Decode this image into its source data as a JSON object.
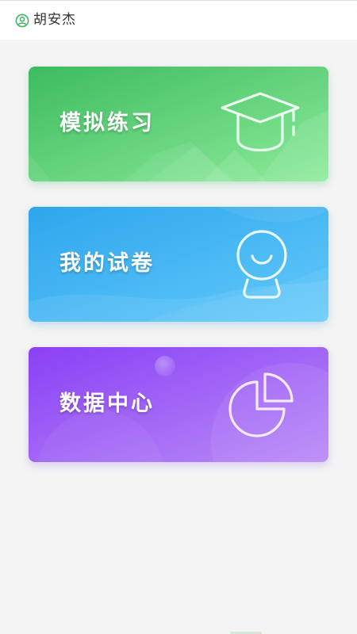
{
  "header": {
    "user_name": "胡安杰",
    "user_icon": "user-circle-icon",
    "accent_color": "#3cb864"
  },
  "cards": [
    {
      "id": "practice",
      "title": "模拟练习",
      "icon": "graduation-cap-icon",
      "gradient": [
        "#3dbb5f",
        "#8ceb9a"
      ]
    },
    {
      "id": "papers",
      "title": "我的试卷",
      "icon": "smiley-person-icon",
      "gradient": [
        "#2ea6ec",
        "#62c9fb"
      ]
    },
    {
      "id": "data",
      "title": "数据中心",
      "icon": "pie-chart-icon",
      "gradient": [
        "#8a40f5",
        "#b98bf7"
      ]
    }
  ]
}
